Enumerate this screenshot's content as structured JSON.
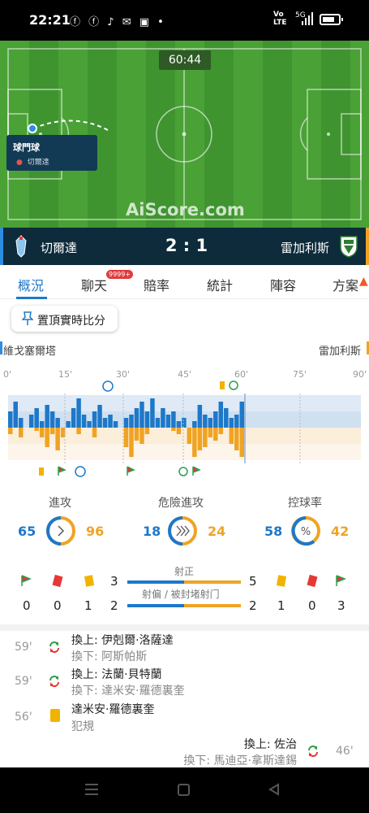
{
  "status_bar": {
    "time": "22:21",
    "apps": "ⓕ ⓕ ♪ ✉ ▣ •",
    "network": "Vo LTE",
    "signal": "5G"
  },
  "pitch": {
    "clock": "60:44",
    "event_title": "球門球",
    "event_player": "切爾達",
    "watermark": "AiScore.com"
  },
  "match": {
    "home_team": "切爾達",
    "away_team": "雷加利斯",
    "score": "2 : 1",
    "home_color": "#2d8de0",
    "away_color": "#f0a323"
  },
  "tabs": [
    {
      "label": "概況"
    },
    {
      "label": "聊天"
    },
    {
      "label": "賠率"
    },
    {
      "label": "統計"
    },
    {
      "label": "陣容"
    },
    {
      "label": "方案"
    }
  ],
  "chat_badge": "9999+",
  "pin_button": "置頂實時比分",
  "teams_row": {
    "home": "維戈塞爾塔",
    "away": "雷加利斯"
  },
  "momentum": {
    "ticks": [
      "0'",
      "15'",
      "30'",
      "45'",
      "60'",
      "75'",
      "90'"
    ],
    "home": [
      0.5,
      0.8,
      0.3,
      0,
      0.4,
      0.6,
      0.2,
      0.7,
      0.5,
      0.3,
      0,
      0.2,
      0.6,
      0.9,
      0.4,
      0.2,
      0.5,
      0.7,
      0.3,
      0.4,
      0.2,
      0,
      0.3,
      0.4,
      0.6,
      0.8,
      0.5,
      0.9,
      0.3,
      0.6,
      0.4,
      0.5,
      0.2,
      0.3,
      0,
      0.2,
      0.7,
      0.4,
      0.3,
      0.5,
      0.8,
      0.6,
      0.3,
      0.4,
      0.8
    ],
    "away": [
      0.2,
      0,
      0.3,
      0,
      0,
      0.1,
      0.3,
      0.6,
      0.2,
      0.7,
      0.3,
      0,
      0,
      0.2,
      0,
      0,
      0.3,
      0,
      0,
      0,
      0,
      0,
      0.6,
      0.9,
      0.4,
      0.5,
      0.2,
      0,
      0,
      0,
      0,
      0.1,
      0.2,
      0,
      0.5,
      0.9,
      0.7,
      0.6,
      0.3,
      0.4,
      0.2,
      0,
      0.5,
      0.7,
      0.9
    ]
  },
  "stats": {
    "attack": {
      "label": "進攻",
      "home": 65,
      "away": 96
    },
    "dangerous": {
      "label": "危險進攻",
      "home": 18,
      "away": 24
    },
    "possession": {
      "label": "控球率",
      "home": 58,
      "away": 42
    }
  },
  "shots": {
    "on_target_label": "射正",
    "off_target_label": "射偏 / 被封堵射门",
    "home_on": "3",
    "away_on": "5",
    "home_off": "2",
    "away_off": "2",
    "home_corners": "0",
    "home_red": "0",
    "home_yellow": "1",
    "away_yellow": "1",
    "away_red": "0",
    "away_corners": "3"
  },
  "events": [
    {
      "minute": "59'",
      "main": "換上: 伊剋爾·洛薩達",
      "sub": "換下: 阿斯帕斯"
    },
    {
      "minute": "59'",
      "main": "換上: 法蘭·貝特蘭",
      "sub": "換下: 達米安·羅德裏奎"
    },
    {
      "minute": "56'",
      "main": "達米安·羅德裏奎",
      "sub": "犯規"
    },
    {
      "minute": "46'",
      "main": "換上: 佐治",
      "sub": "換下: 馬迪亞·拿斯達錫"
    }
  ]
}
